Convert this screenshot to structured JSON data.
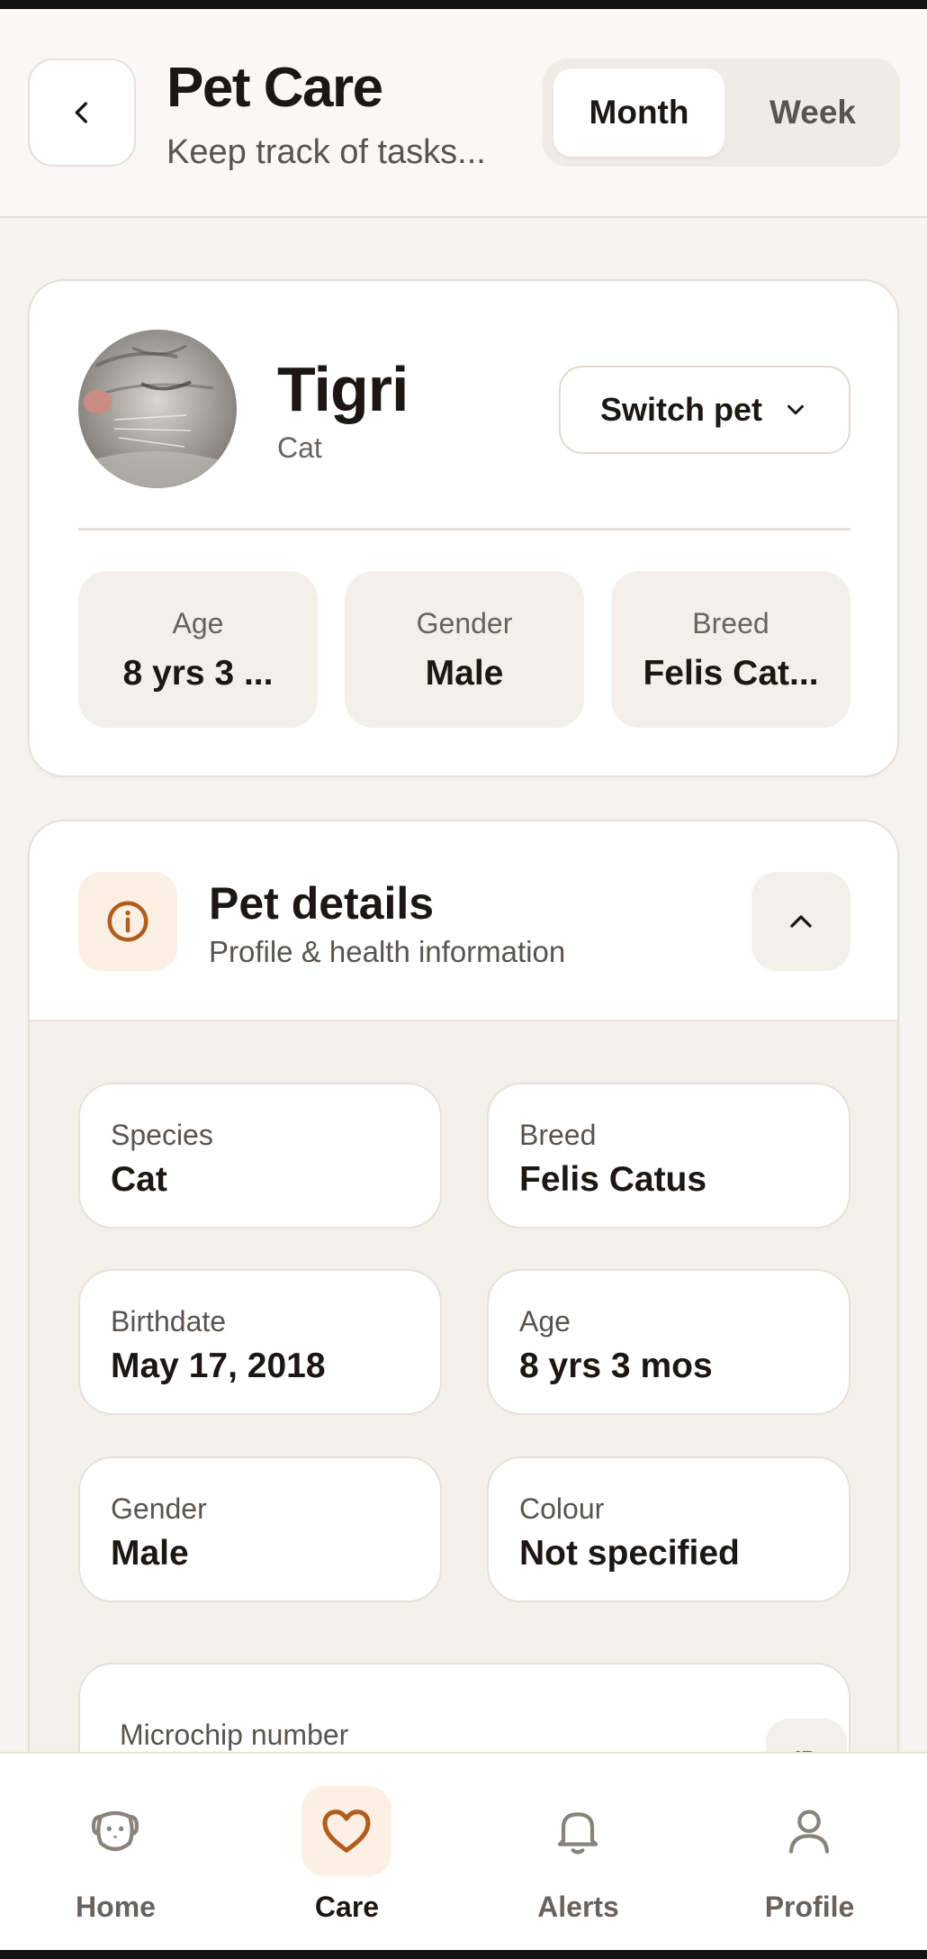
{
  "header": {
    "title": "Pet Care",
    "subtitle": "Keep track of tasks...",
    "view_toggle": {
      "month_label": "Month",
      "week_label": "Week",
      "selected": "Month"
    }
  },
  "pet": {
    "name": "Tigri",
    "species": "Cat",
    "switch_label": "Switch pet",
    "stats": [
      {
        "label": "Age",
        "value": "8 yrs 3 ..."
      },
      {
        "label": "Gender",
        "value": "Male"
      },
      {
        "label": "Breed",
        "value": "Felis Cat..."
      }
    ]
  },
  "details": {
    "title": "Pet details",
    "subtitle": "Profile & health information",
    "fields": [
      {
        "label": "Species",
        "value": "Cat"
      },
      {
        "label": "Breed",
        "value": "Felis Catus"
      },
      {
        "label": "Birthdate",
        "value": "May 17, 2018"
      },
      {
        "label": "Age",
        "value": "8 yrs 3 mos"
      },
      {
        "label": "Gender",
        "value": "Male"
      },
      {
        "label": "Colour",
        "value": "Not specified"
      }
    ],
    "microchip_label": "Microchip number",
    "microchip_badge": "ID"
  },
  "nav": {
    "items": [
      {
        "label": "Home",
        "icon": "dog-icon"
      },
      {
        "label": "Care",
        "icon": "heart-icon",
        "active": true
      },
      {
        "label": "Alerts",
        "icon": "bell-icon"
      },
      {
        "label": "Profile",
        "icon": "user-icon"
      }
    ]
  },
  "colors": {
    "accent": "#b25d1c",
    "accent_bg": "#fcefe4",
    "background": "#f6f4f0"
  }
}
